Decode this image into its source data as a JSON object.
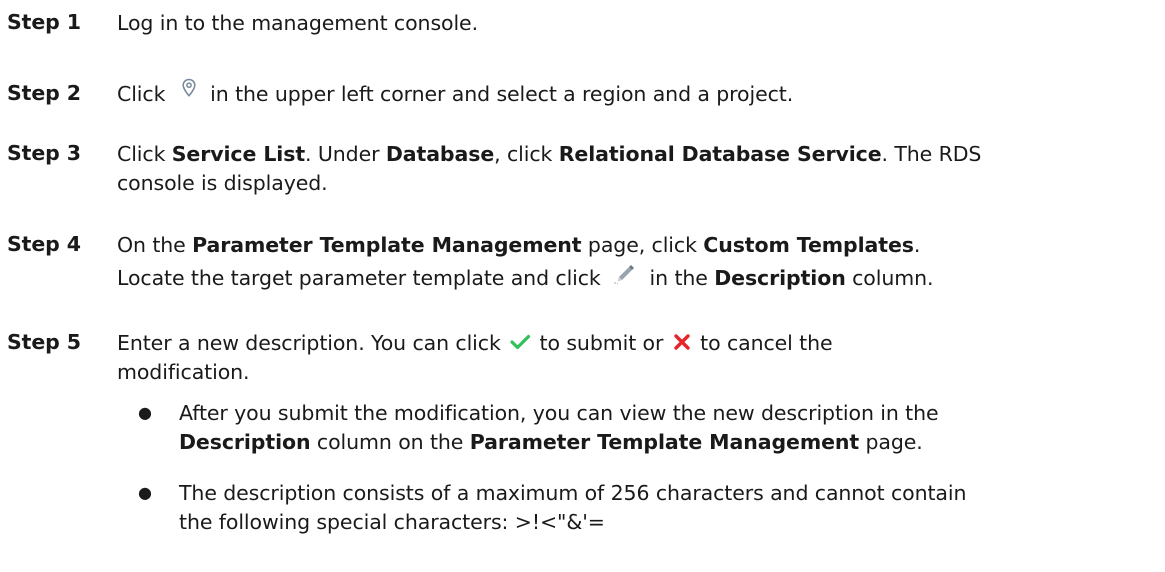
{
  "steps": [
    {
      "label": "Step 1",
      "lines": [
        {
          "t1": "Log in to the management console."
        }
      ]
    },
    {
      "label": "Step 2",
      "lines": [
        {
          "t1": "Click ",
          "icon": "location-pin-icon",
          "t2": " in the upper left corner and select a region and a project."
        }
      ]
    },
    {
      "label": "Step 3",
      "lines": [
        {
          "t1": "Click ",
          "b1": "Service List",
          "t2": ". Under ",
          "b2": "Database",
          "t3": ", click ",
          "b3": "Relational Database Service",
          "t4": ". The RDS"
        },
        {
          "t1": "console is displayed."
        }
      ]
    },
    {
      "label": "Step 4",
      "lines": [
        {
          "t1": "On the ",
          "b1": "Parameter Template Management",
          "t2": " page, click ",
          "b2": "Custom Templates",
          "t3": "."
        },
        {
          "t1": "Locate the target parameter template and click ",
          "icon": "pencil-edit-icon",
          "t2": " in the ",
          "b1": "Description",
          "t3": " column."
        }
      ]
    },
    {
      "label": "Step 5",
      "lines": [
        {
          "t1": "Enter a new description. You can click ",
          "icon1": "checkmark-icon",
          "t2": " to submit or ",
          "icon2": "cross-icon",
          "t3": " to cancel the"
        },
        {
          "t1": "modification."
        }
      ],
      "bullets": [
        {
          "lines": [
            {
              "t1": "After you submit the modification, you can view the new description in the"
            },
            {
              "b1": "Description",
              "t1": " column on the ",
              "b2": "Parameter Template Management",
              "t2": " page."
            }
          ]
        },
        {
          "lines": [
            {
              "t1": "The description consists of a maximum of 256 characters and cannot contain"
            },
            {
              "t1": "the following special characters: >!<\"&'="
            }
          ]
        }
      ]
    }
  ],
  "colors": {
    "text": "#1a1a1a",
    "check": "#2fc25b",
    "cross": "#e8232a",
    "pin": "#7a8a9a"
  },
  "bullet_char": "●"
}
